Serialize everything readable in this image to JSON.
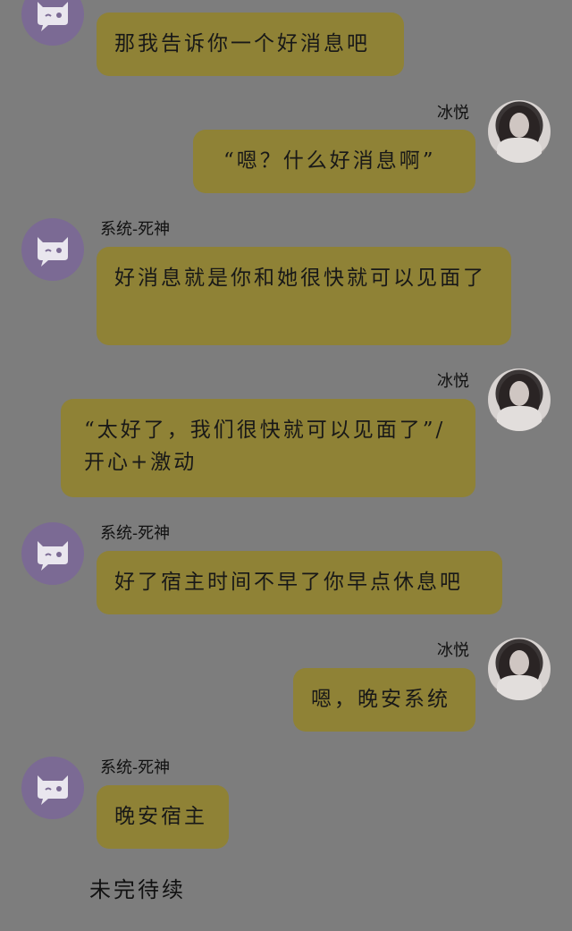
{
  "bot": {
    "name": "系统-死神",
    "avatar_icon": "cat-face-chat-bubble-icon"
  },
  "user": {
    "name": "冰悦",
    "avatar_icon": "user-photo-avatar"
  },
  "messages": [
    {
      "sender": "bot",
      "text": "那我告诉你一个好消息吧"
    },
    {
      "sender": "user",
      "text": "“嗯？什么好消息啊”"
    },
    {
      "sender": "bot",
      "text": "好消息就是你和她很快就可以见面了"
    },
    {
      "sender": "user",
      "text": "“太好了，我们很快就可以见面了”/开心+激动"
    },
    {
      "sender": "bot",
      "text": "好了宿主时间不早了你早点休息吧"
    },
    {
      "sender": "user",
      "text": "嗯，晚安系统"
    },
    {
      "sender": "bot",
      "text": "晚安宿主"
    }
  ],
  "footer_text": "未完待续",
  "colors": {
    "background": "#7d7d7d",
    "bubble": "#8f8236",
    "bot_avatar": "#7b6a94"
  }
}
